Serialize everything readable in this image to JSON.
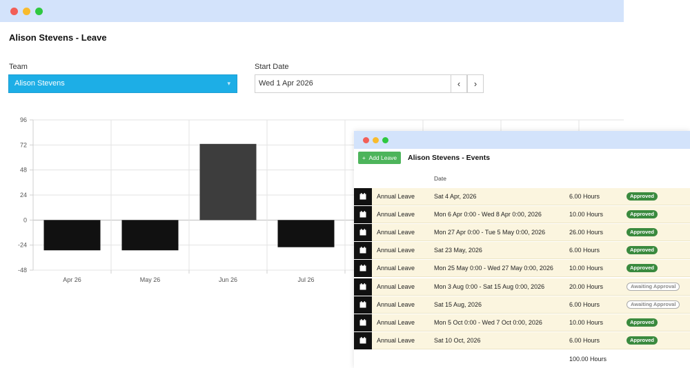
{
  "colors": {
    "titlebar": "#d3e3fb",
    "team_select_bg": "#1daee6",
    "bar_negative": "#111111",
    "bar_positive": "#3d3d3d",
    "row_bg": "#fbf5df",
    "approved": "#3a8a3e",
    "add_button": "#4db45b"
  },
  "page": {
    "title": "Alison Stevens - Leave"
  },
  "filters": {
    "team_label": "Team",
    "team_value": "Alison Stevens",
    "start_date_label": "Start Date",
    "start_date_value": "Wed 1 Apr 2026",
    "prev": "‹",
    "next": "›"
  },
  "chart_data": {
    "type": "bar",
    "categories": [
      "Apr 26",
      "May 26",
      "Jun 26",
      "Jul 26"
    ],
    "values": [
      -29,
      -29,
      73,
      -26
    ],
    "y_ticks": [
      96,
      72,
      48,
      24,
      0,
      -24,
      -48
    ],
    "ylim": [
      -48,
      96
    ],
    "grid": true,
    "xlabel": "",
    "ylabel": ""
  },
  "events": {
    "add_label": "Add Leave",
    "title": "Alison Stevens - Events",
    "date_header": "Date",
    "rows": [
      {
        "type": "Annual Leave",
        "date": "Sat 4 Apr, 2026",
        "hours": "6.00 Hours",
        "status": "Approved",
        "status_kind": "approved"
      },
      {
        "type": "Annual Leave",
        "date": "Mon 6 Apr 0:00 - Wed 8 Apr 0:00, 2026",
        "hours": "10.00 Hours",
        "status": "Approved",
        "status_kind": "approved"
      },
      {
        "type": "Annual Leave",
        "date": "Mon 27 Apr 0:00 - Tue 5 May 0:00, 2026",
        "hours": "26.00 Hours",
        "status": "Approved",
        "status_kind": "approved"
      },
      {
        "type": "Annual Leave",
        "date": "Sat 23 May, 2026",
        "hours": "6.00 Hours",
        "status": "Approved",
        "status_kind": "approved"
      },
      {
        "type": "Annual Leave",
        "date": "Mon 25 May 0:00 - Wed 27 May 0:00, 2026",
        "hours": "10.00 Hours",
        "status": "Approved",
        "status_kind": "approved"
      },
      {
        "type": "Annual Leave",
        "date": "Mon 3 Aug 0:00 - Sat 15 Aug 0:00, 2026",
        "hours": "20.00 Hours",
        "status": "Awaiting Approval",
        "status_kind": "awaiting"
      },
      {
        "type": "Annual Leave",
        "date": "Sat 15 Aug, 2026",
        "hours": "6.00 Hours",
        "status": "Awaiting Approval",
        "status_kind": "awaiting"
      },
      {
        "type": "Annual Leave",
        "date": "Mon 5 Oct 0:00 - Wed 7 Oct 0:00, 2026",
        "hours": "10.00 Hours",
        "status": "Approved",
        "status_kind": "approved"
      },
      {
        "type": "Annual Leave",
        "date": "Sat 10 Oct, 2026",
        "hours": "6.00 Hours",
        "status": "Approved",
        "status_kind": "approved"
      }
    ],
    "total": "100.00 Hours"
  }
}
